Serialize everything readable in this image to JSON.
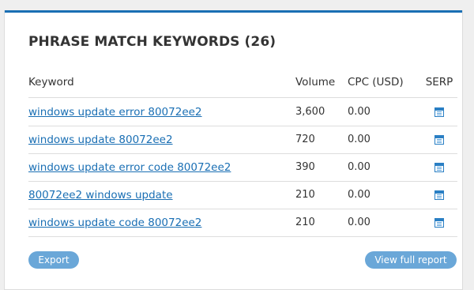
{
  "widget": {
    "title": "PHRASE MATCH KEYWORDS (26)"
  },
  "table": {
    "headers": {
      "keyword": "Keyword",
      "volume": "Volume",
      "cpc": "CPC (USD)",
      "serp": "SERP"
    },
    "rows": [
      {
        "keyword": "windows update error 80072ee2",
        "volume": "3,600",
        "cpc": "0.00",
        "serp_icon": "serp-page-icon"
      },
      {
        "keyword": "windows update 80072ee2",
        "volume": "720",
        "cpc": "0.00",
        "serp_icon": "serp-page-icon"
      },
      {
        "keyword": "windows update error code 80072ee2",
        "volume": "390",
        "cpc": "0.00",
        "serp_icon": "serp-page-icon"
      },
      {
        "keyword": "80072ee2 windows update",
        "volume": "210",
        "cpc": "0.00",
        "serp_icon": "serp-page-icon"
      },
      {
        "keyword": "windows update code 80072ee2",
        "volume": "210",
        "cpc": "0.00",
        "serp_icon": "serp-page-icon"
      }
    ]
  },
  "buttons": {
    "export_label": "Export",
    "view_full_report_label": "View full report"
  },
  "colors": {
    "accent": "#1a6fb4",
    "button_bg": "#6aa7d8",
    "link": "#1a6fb4"
  }
}
